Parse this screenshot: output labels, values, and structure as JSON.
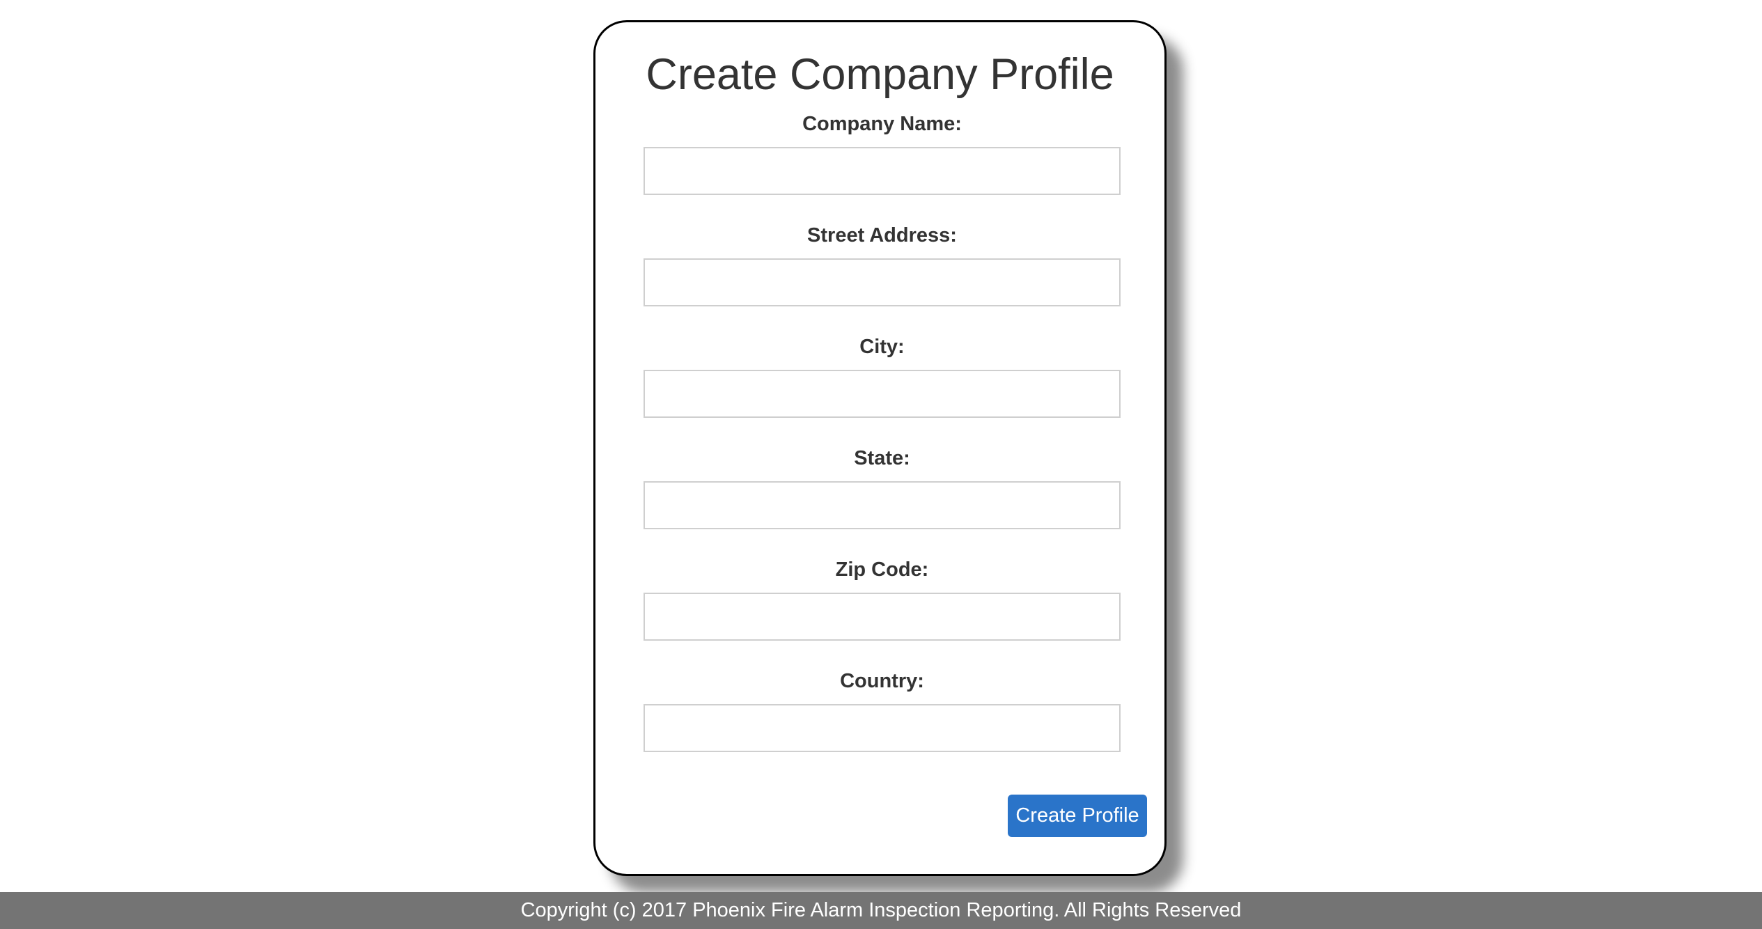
{
  "form": {
    "title": "Create Company Profile",
    "fields": [
      {
        "label": "Company Name:",
        "value": "",
        "placeholder": ""
      },
      {
        "label": "Street Address:",
        "value": "",
        "placeholder": ""
      },
      {
        "label": "City:",
        "value": "",
        "placeholder": ""
      },
      {
        "label": "State:",
        "value": "",
        "placeholder": ""
      },
      {
        "label": "Zip Code:",
        "value": "",
        "placeholder": ""
      },
      {
        "label": "Country:",
        "value": "",
        "placeholder": ""
      }
    ],
    "submit_label": "Create Profile"
  },
  "footer": {
    "text": "Copyright (c) 2017 Phoenix Fire Alarm Inspection Reporting. All Rights Reserved"
  },
  "colors": {
    "button_bg": "#2a74c9",
    "footer_bg": "#747474",
    "text": "#333333"
  }
}
